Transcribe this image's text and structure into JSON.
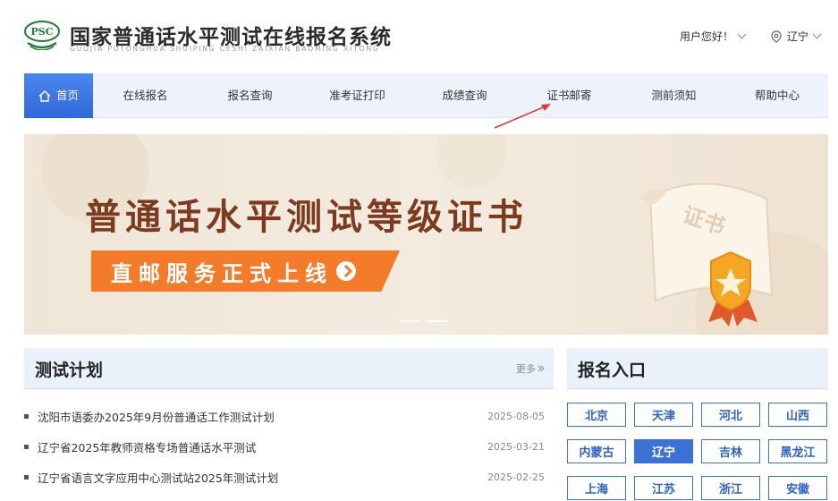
{
  "header": {
    "logo_text": "PSC",
    "title": "国家普通话水平测试在线报名系统",
    "subtitle": "GUOJIA PUTONGHUA SHUIPING CESHI ZAIXIAN BAOMING XITONG",
    "user_greeting": "用户您好！",
    "location": "辽宁"
  },
  "nav": {
    "items": [
      {
        "label": "首页"
      },
      {
        "label": "在线报名"
      },
      {
        "label": "报名查询"
      },
      {
        "label": "准考证打印"
      },
      {
        "label": "成绩查询"
      },
      {
        "label": "证书邮寄"
      },
      {
        "label": "测前须知"
      },
      {
        "label": "帮助中心"
      }
    ]
  },
  "banner": {
    "title": "普通话水平测试等级证书",
    "button_label": "直邮服务正式上线",
    "scroll_text": "证书"
  },
  "plan": {
    "title": "测试计划",
    "more_label": "更多",
    "items": [
      {
        "text": "沈阳市语委办2025年9月份普通话工作测试计划",
        "date": "2025-08-05"
      },
      {
        "text": "辽宁省2025年教师资格专场普通话水平测试",
        "date": "2025-03-21"
      },
      {
        "text": "辽宁省语言文字应用中心测试站2025年测试计划",
        "date": "2025-02-25"
      }
    ]
  },
  "registration": {
    "title": "报名入口",
    "provinces": [
      {
        "name": "北京"
      },
      {
        "name": "天津"
      },
      {
        "name": "河北"
      },
      {
        "name": "山西"
      },
      {
        "name": "内蒙古"
      },
      {
        "name": "辽宁"
      },
      {
        "name": "吉林"
      },
      {
        "name": "黑龙江"
      },
      {
        "name": "上海"
      },
      {
        "name": "江苏"
      },
      {
        "name": "浙江"
      },
      {
        "name": "安徽"
      }
    ]
  },
  "colors": {
    "accent": "#3a72d8",
    "banner_orange": "#f47b2a",
    "banner_brown": "#7d3a1f",
    "annotation_arrow": "#e0392b"
  }
}
